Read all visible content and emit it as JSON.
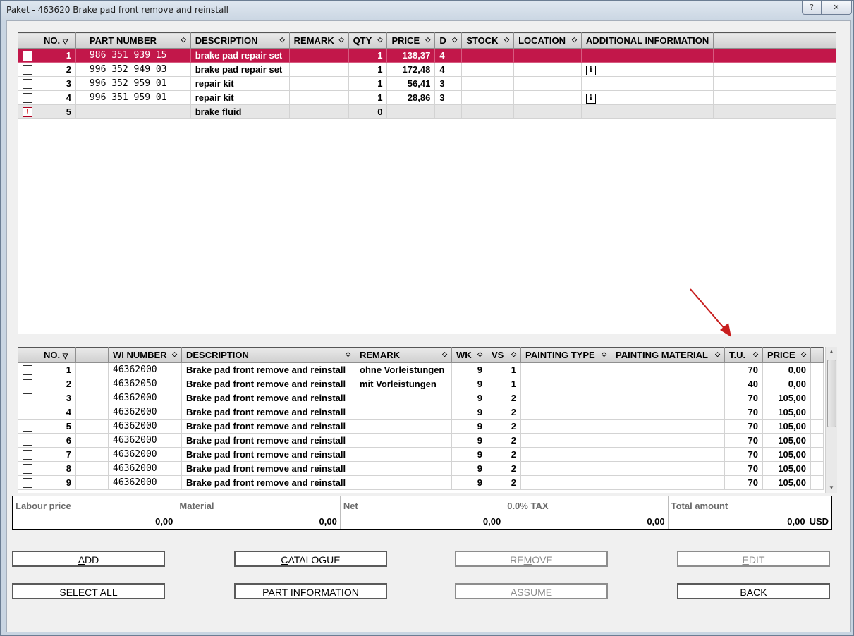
{
  "window": {
    "title": "Paket - 463620 Brake pad front remove and reinstall",
    "help_label": "?",
    "close_label": "✕"
  },
  "parts": {
    "columns": [
      "",
      "NO.",
      "",
      "PART NUMBER",
      "DESCRIPTION",
      "REMARK",
      "QTY",
      "PRICE",
      "D",
      "STOCK",
      "LOCATION",
      "ADDITIONAL INFORMATION",
      ""
    ],
    "rows": [
      {
        "no": "1",
        "part_number": "986 351 939 15",
        "description": "brake pad repair set",
        "remark": "",
        "qty": "1",
        "price": "138,37",
        "d": "4",
        "stock": "",
        "location": "",
        "info": false,
        "selected": true,
        "warn": false
      },
      {
        "no": "2",
        "part_number": "996 352 949 03",
        "description": "brake pad repair set",
        "remark": "",
        "qty": "1",
        "price": "172,48",
        "d": "4",
        "stock": "",
        "location": "",
        "info": true,
        "selected": false,
        "warn": false
      },
      {
        "no": "3",
        "part_number": "996 352 959 01",
        "description": "repair kit",
        "remark": "",
        "qty": "1",
        "price": "56,41",
        "d": "3",
        "stock": "",
        "location": "",
        "info": false,
        "selected": false,
        "warn": false
      },
      {
        "no": "4",
        "part_number": "996 351 959 01",
        "description": "repair kit",
        "remark": "",
        "qty": "1",
        "price": "28,86",
        "d": "3",
        "stock": "",
        "location": "",
        "info": true,
        "selected": false,
        "warn": false
      },
      {
        "no": "5",
        "part_number": "",
        "description": "brake fluid",
        "remark": "",
        "qty": "0",
        "price": "",
        "d": "",
        "stock": "",
        "location": "",
        "info": false,
        "selected": false,
        "warn": true
      }
    ]
  },
  "labour": {
    "columns": [
      "",
      "NO.",
      "",
      "WI NUMBER",
      "DESCRIPTION",
      "REMARK",
      "WK",
      "VS",
      "PAINTING TYPE",
      "PAINTING MATERIAL",
      "T.U.",
      "PRICE",
      ""
    ],
    "rows": [
      {
        "no": "1",
        "wi": "46362000",
        "description": "Brake pad front remove and reinstall",
        "remark": "ohne Vorleistungen",
        "wk": "9",
        "vs": "1",
        "ptype": "",
        "pmat": "",
        "tu": "70",
        "price": "0,00"
      },
      {
        "no": "2",
        "wi": "46362050",
        "description": "Brake pad front remove and reinstall",
        "remark": "mit Vorleistungen",
        "wk": "9",
        "vs": "1",
        "ptype": "",
        "pmat": "",
        "tu": "40",
        "price": "0,00"
      },
      {
        "no": "3",
        "wi": "46362000",
        "description": "Brake pad front remove and reinstall",
        "remark": "",
        "wk": "9",
        "vs": "2",
        "ptype": "",
        "pmat": "",
        "tu": "70",
        "price": "105,00"
      },
      {
        "no": "4",
        "wi": "46362000",
        "description": "Brake pad front remove and reinstall",
        "remark": "",
        "wk": "9",
        "vs": "2",
        "ptype": "",
        "pmat": "",
        "tu": "70",
        "price": "105,00"
      },
      {
        "no": "5",
        "wi": "46362000",
        "description": "Brake pad front remove and reinstall",
        "remark": "",
        "wk": "9",
        "vs": "2",
        "ptype": "",
        "pmat": "",
        "tu": "70",
        "price": "105,00"
      },
      {
        "no": "6",
        "wi": "46362000",
        "description": "Brake pad front remove and reinstall",
        "remark": "",
        "wk": "9",
        "vs": "2",
        "ptype": "",
        "pmat": "",
        "tu": "70",
        "price": "105,00"
      },
      {
        "no": "7",
        "wi": "46362000",
        "description": "Brake pad front remove and reinstall",
        "remark": "",
        "wk": "9",
        "vs": "2",
        "ptype": "",
        "pmat": "",
        "tu": "70",
        "price": "105,00"
      },
      {
        "no": "8",
        "wi": "46362000",
        "description": "Brake pad front remove and reinstall",
        "remark": "",
        "wk": "9",
        "vs": "2",
        "ptype": "",
        "pmat": "",
        "tu": "70",
        "price": "105,00"
      },
      {
        "no": "9",
        "wi": "46362000",
        "description": "Brake pad front remove and reinstall",
        "remark": "",
        "wk": "9",
        "vs": "2",
        "ptype": "",
        "pmat": "",
        "tu": "70",
        "price": "105,00"
      }
    ]
  },
  "totals": {
    "labour_label": "Labour price",
    "labour_value": "0,00",
    "material_label": "Material",
    "material_value": "0,00",
    "net_label": "Net",
    "net_value": "0,00",
    "tax_label": "0.0% TAX",
    "tax_value": "0,00",
    "total_label": "Total amount",
    "total_value": "0,00",
    "currency": "USD"
  },
  "buttons": {
    "add": {
      "pre": "",
      "u": "A",
      "post": "DD"
    },
    "catalogue": {
      "pre": "",
      "u": "C",
      "post": "ATALOGUE"
    },
    "remove": {
      "pre": "RE",
      "u": "M",
      "post": "OVE"
    },
    "edit": {
      "pre": "",
      "u": "E",
      "post": "DIT"
    },
    "select_all": {
      "pre": "",
      "u": "S",
      "post": "ELECT ALL"
    },
    "part_information": {
      "pre": "",
      "u": "P",
      "post": "ART INFORMATION"
    },
    "assume": {
      "pre": "ASS",
      "u": "U",
      "post": "ME"
    },
    "back": {
      "pre": "",
      "u": "B",
      "post": "ACK"
    }
  },
  "colors": {
    "selected_row": "#c2174a",
    "annotation_arrow": "#c81e1e"
  }
}
